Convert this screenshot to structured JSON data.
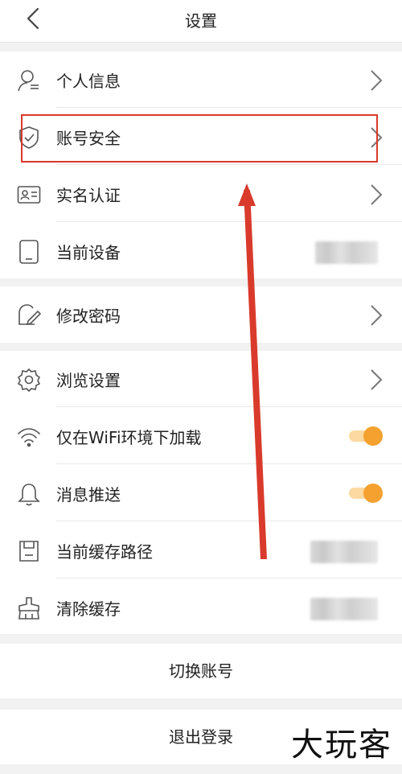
{
  "header": {
    "title": "设置"
  },
  "account_section": {
    "items": [
      {
        "label": "个人信息"
      },
      {
        "label": "账号安全"
      },
      {
        "label": "实名认证"
      },
      {
        "label": "当前设备"
      }
    ]
  },
  "password_section": {
    "items": [
      {
        "label": "修改密码"
      }
    ]
  },
  "general_section": {
    "items": [
      {
        "label": "浏览设置"
      },
      {
        "label": "仅在WiFi环境下加载",
        "toggle_on": true
      },
      {
        "label": "消息推送",
        "toggle_on": true
      },
      {
        "label": "当前缓存路径"
      },
      {
        "label": "清除缓存"
      }
    ]
  },
  "buttons": {
    "switch_account": "切换账号",
    "logout": "退出登录"
  },
  "watermark": "大玩客",
  "colors": {
    "accent": "#f4a130",
    "highlight": "#d93a2b"
  }
}
